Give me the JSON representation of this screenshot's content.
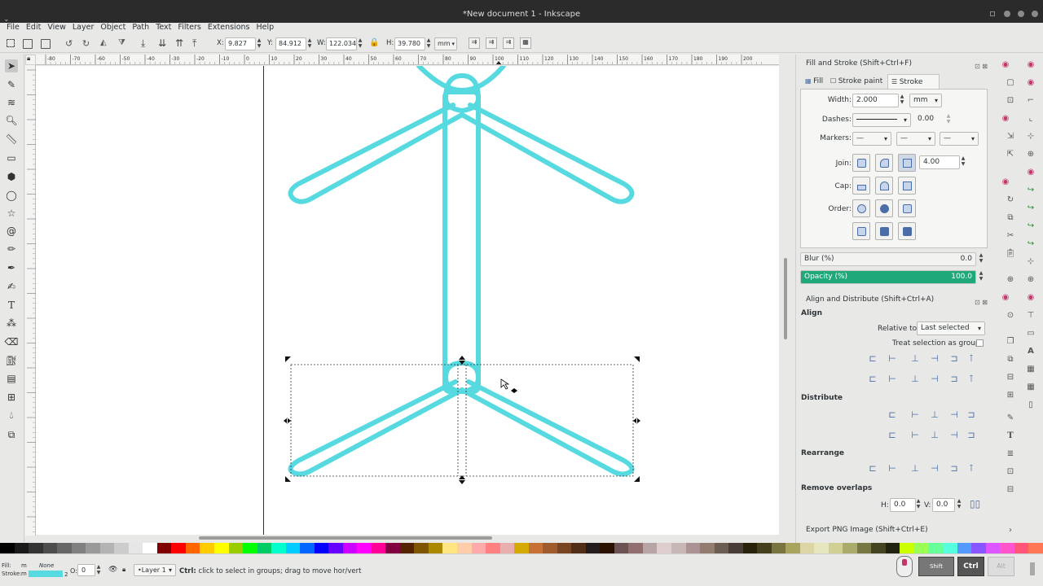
{
  "window": {
    "title": "*New document 1 - Inkscape"
  },
  "menu": [
    "File",
    "Edit",
    "View",
    "Layer",
    "Object",
    "Path",
    "Text",
    "Filters",
    "Extensions",
    "Help"
  ],
  "toolbar": {
    "x_label": "X:",
    "x_value": "9.827",
    "y_label": "Y:",
    "y_value": "84.912",
    "w_label": "W:",
    "w_value": "122.034",
    "h_label": "H:",
    "h_value": "39.780",
    "unit": "mm"
  },
  "ruler": {
    "labels": [
      "-80",
      "-70",
      "-60",
      "-50",
      "-40",
      "-30",
      "-20",
      "-10",
      "0",
      "10",
      "20",
      "30",
      "40",
      "50",
      "60",
      "70",
      "80",
      "90",
      "100",
      "110",
      "120",
      "130",
      "140",
      "150",
      "160",
      "170",
      "180",
      "190",
      "200"
    ]
  },
  "fill_stroke": {
    "title": "Fill and Stroke (Shift+Ctrl+F)",
    "tabs": [
      "Fill",
      "Stroke paint",
      "Stroke style"
    ],
    "width_label": "Width:",
    "width_value": "2.000",
    "width_unit": "mm",
    "dashes_label": "Dashes:",
    "dashes_value": "0.00",
    "markers_label": "Markers:",
    "join_label": "Join:",
    "join_value": "4.00",
    "cap_label": "Cap:",
    "order_label": "Order:",
    "blur_label": "Blur (%)",
    "blur_value": "0.0",
    "opacity_label": "Opacity (%)",
    "opacity_value": "100.0",
    "opacity_fraction": 1.0
  },
  "align": {
    "title": "Align and Distribute (Shift+Ctrl+A)",
    "align_heading": "Align",
    "relative_label": "Relative to:",
    "relative_value": "Last selected",
    "treat_group_label": "Treat selection as group:",
    "distribute_heading": "Distribute",
    "rearrange_heading": "Rearrange",
    "remove_overlaps_heading": "Remove overlaps",
    "h_label": "H:",
    "h_value": "0.0",
    "v_label": "V:",
    "v_value": "0.0"
  },
  "export": {
    "title": "Export PNG Image (Shift+Ctrl+E)"
  },
  "status": {
    "fill_label": "Fill:",
    "fill_value": "m",
    "stroke_label": "Stroke:",
    "stroke_value": "m",
    "none_label": "None",
    "stroke_width": "2",
    "opacity_label": "O:",
    "opacity_value": "0",
    "layer": "•Layer 1",
    "message_bold": "Ctrl:",
    "message": " click to select in groups; drag to move hor/vert",
    "keys": [
      "Shift",
      "Ctrl",
      "Alt"
    ]
  },
  "colors": {
    "stroke": "#57d9e0",
    "opacity_bar": "#1fa97a",
    "accent": "#4a6da7"
  },
  "palette": [
    "#000000",
    "#1a1a1a",
    "#333333",
    "#4d4d4d",
    "#666666",
    "#808080",
    "#999999",
    "#b3b3b3",
    "#cccccc",
    "#e6e6e6",
    "#ffffff",
    "#800000",
    "#ff0000",
    "#ff6600",
    "#ffcc00",
    "#ffff00",
    "#99cc00",
    "#00ff00",
    "#00cc66",
    "#00ffcc",
    "#00ccff",
    "#0066ff",
    "#0000ff",
    "#6600ff",
    "#cc00ff",
    "#ff00ff",
    "#ff0099",
    "#800040",
    "#552200",
    "#805500",
    "#aa8800",
    "#ffe680",
    "#ffccaa",
    "#ffaaaa",
    "#ff8080",
    "#e9afaf",
    "#d4aa00",
    "#c87137",
    "#a05a2c",
    "#784421",
    "#502d16",
    "#241c1c",
    "#2b1100",
    "#6c5353",
    "#916f6f",
    "#b7a5a5",
    "#decdcd",
    "#c8b7b7",
    "#ac9393",
    "#917c6f",
    "#6c5d53",
    "#483e37",
    "#28220b",
    "#443f1c",
    "#78753f",
    "#a8a35f",
    "#dcd6a7",
    "#e6e6be",
    "#d0d094",
    "#aaaa6a",
    "#777744",
    "#444422",
    "#222211",
    "#ccff00",
    "#99ff55",
    "#66ff99",
    "#55ffdd",
    "#5599ff",
    "#8855ff",
    "#dd55ff",
    "#ff55cc",
    "#ff5577",
    "#ff7755"
  ]
}
